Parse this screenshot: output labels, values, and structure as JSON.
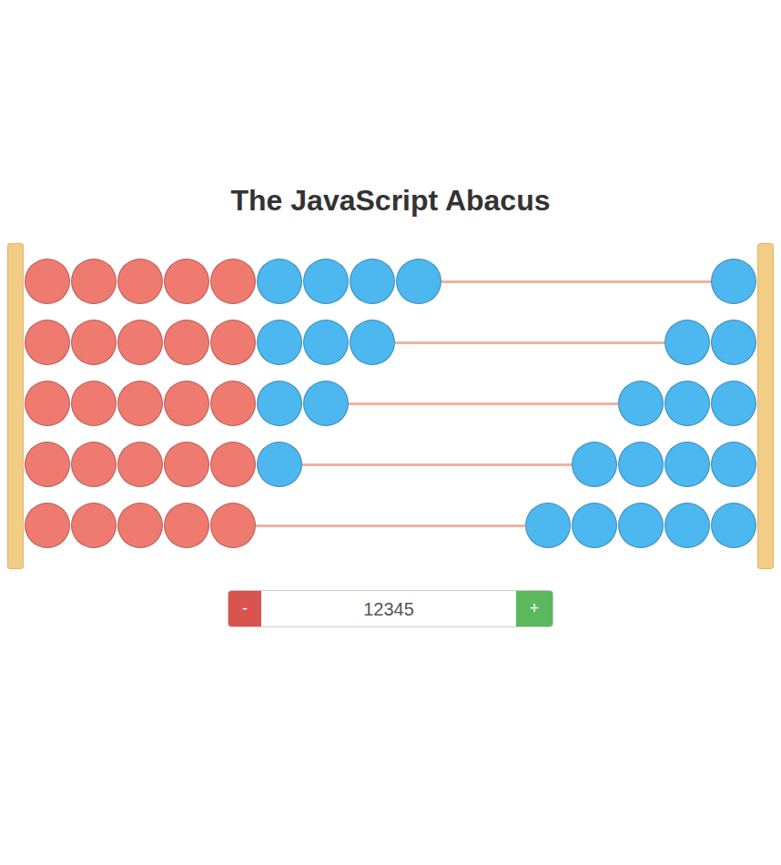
{
  "title": "The JavaScript Abacus",
  "abacus": {
    "bead_colors": [
      "#ef7a70",
      "#ef7a70",
      "#ef7a70",
      "#ef7a70",
      "#ef7a70",
      "#4db7ef",
      "#4db7ef",
      "#4db7ef",
      "#4db7ef",
      "#4db7ef"
    ],
    "rows": [
      {
        "moved": 1
      },
      {
        "moved": 2
      },
      {
        "moved": 3
      },
      {
        "moved": 4
      },
      {
        "moved": 5
      }
    ]
  },
  "controls": {
    "minus": "-",
    "value": "12345",
    "plus": "+"
  }
}
